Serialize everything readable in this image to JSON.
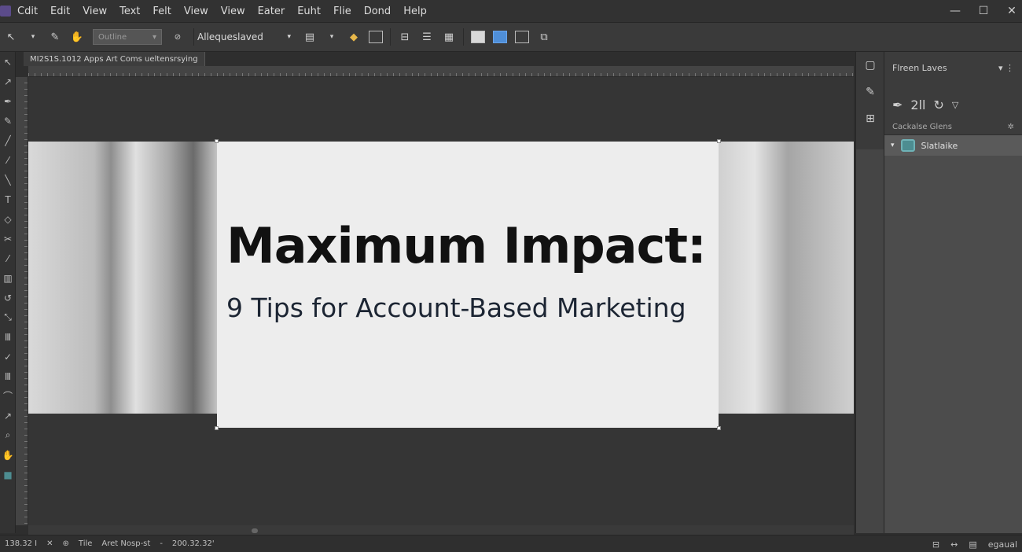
{
  "menubar": {
    "items": [
      "Cdit",
      "Edit",
      "View",
      "Text",
      "Felt",
      "View",
      "View",
      "Eater",
      "Euht",
      "Flie",
      "Dond",
      "Help"
    ],
    "window_controls": [
      "—",
      "☐",
      "✕"
    ]
  },
  "optbar": {
    "preset_select": "Outline",
    "font_select": "Allequeslaved"
  },
  "document": {
    "tab_label": "MI2S1S.1012 Apps Art Coms ueltensrsying"
  },
  "canvas": {
    "headline": "Maximum Impact:",
    "subhead": "9 Tips for Account-Based Marketing"
  },
  "panel": {
    "title": "Flreen Laves",
    "tools_text": "2ll",
    "section_label": "Cackalse Glens",
    "layer_name": "Slatlaike"
  },
  "status": {
    "zoom": "138.32 I",
    "file_label": "Tile",
    "doc_label": "Aret Nosp-st",
    "coords": "200.32.32'",
    "right_text": "egaual"
  },
  "icons": {
    "app_logo": "app-logo-icon",
    "close": "close-icon",
    "maximize": "maximize-icon",
    "minimize": "minimize-icon"
  },
  "colors": {
    "accent_blue": "#4f8fd9",
    "layer_thumb": "#4d8d91"
  }
}
